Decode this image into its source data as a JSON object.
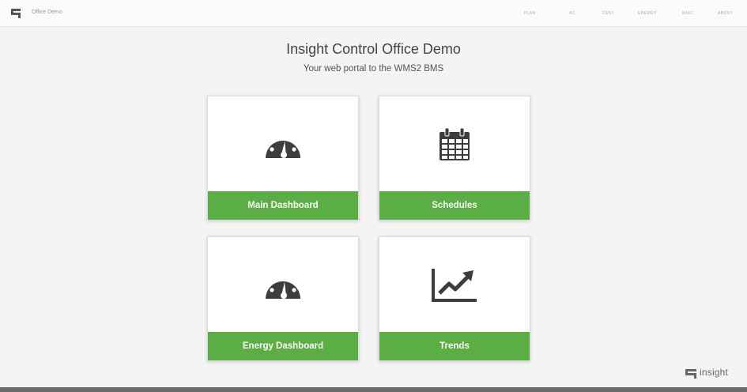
{
  "header": {
    "app_title": "Office Demo",
    "nav": [
      "PLAN",
      "AC",
      "CENT",
      "ENERGY",
      "MISC",
      "ABOUT"
    ]
  },
  "hero": {
    "title": "Insight Control Office Demo",
    "subtitle": "Your web portal to the WMS2 BMS"
  },
  "tiles": [
    {
      "label": "Main Dashboard",
      "icon": "dashboard-gauge-icon"
    },
    {
      "label": "Schedules",
      "icon": "calendar-icon"
    },
    {
      "label": "Energy Dashboard",
      "icon": "dashboard-gauge-icon"
    },
    {
      "label": "Trends",
      "icon": "line-chart-icon"
    }
  ],
  "footer": {
    "brand": "insight"
  },
  "colors": {
    "accent": "#5aae43",
    "icon": "#3d3d3d",
    "background": "#f4f4f4"
  }
}
